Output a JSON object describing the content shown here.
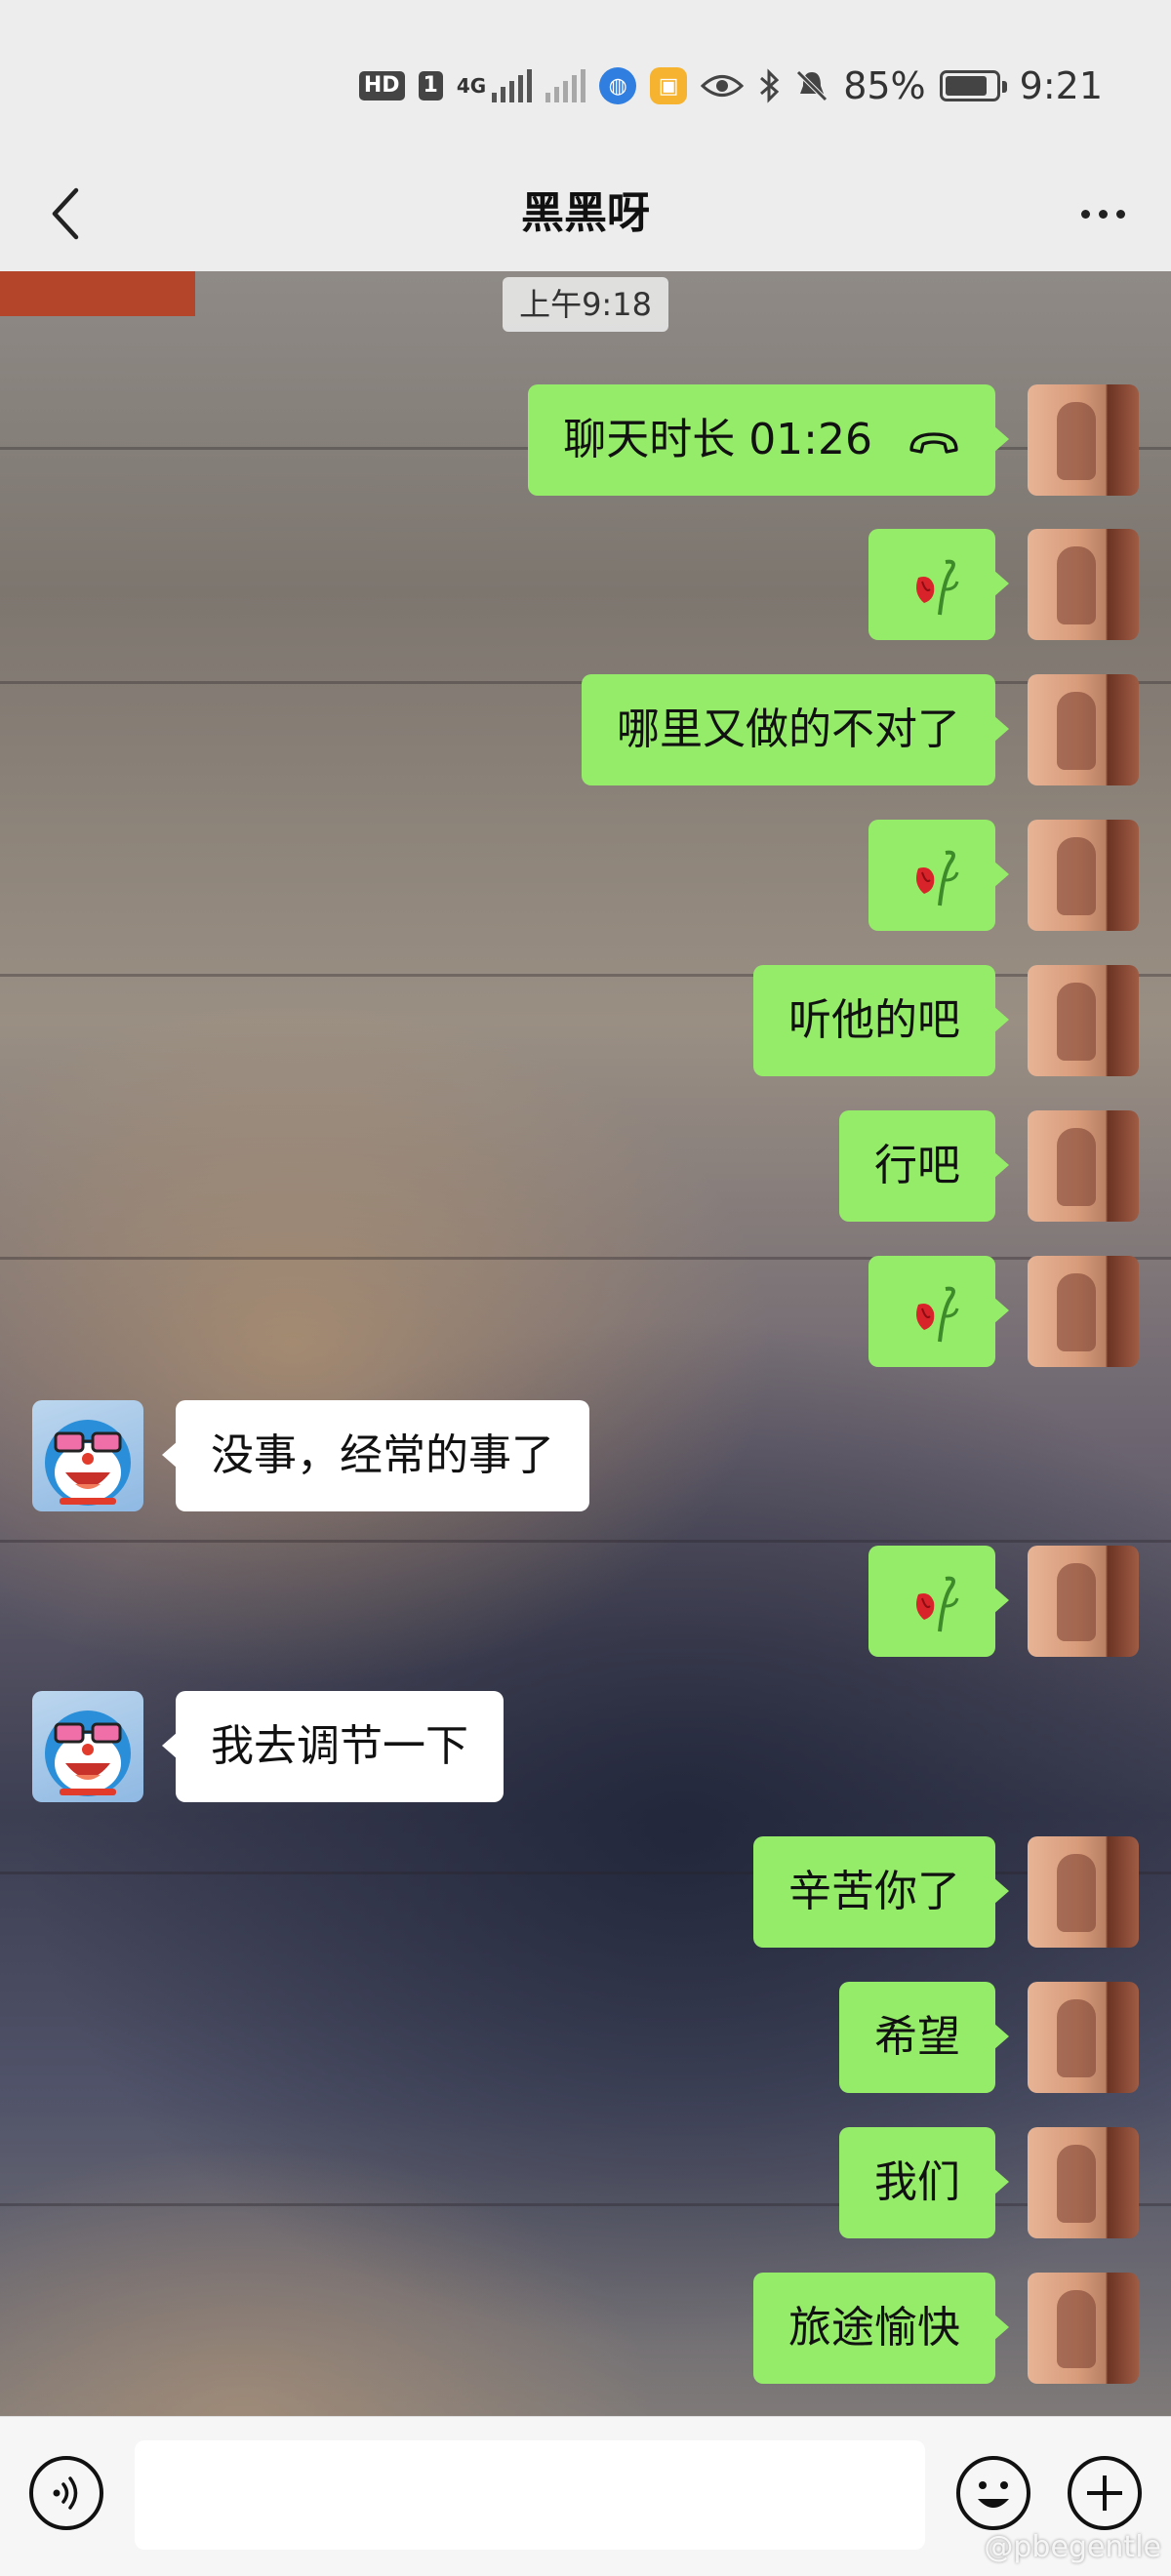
{
  "status_bar": {
    "hd_badge": "HD",
    "sim_badge": "1",
    "network": "4G",
    "battery": "85%",
    "time": "9:21",
    "icons": [
      "hd-icon",
      "signal-icon",
      "no-signal-icon",
      "browser-icon",
      "app-notification-icon",
      "eye-icon",
      "bluetooth-icon",
      "mute-icon",
      "battery-icon"
    ],
    "battery_level": 0.85
  },
  "nav": {
    "title": "黑黑呀",
    "back_icon": "chevron-left-icon",
    "more_icon": "more-dots-icon"
  },
  "chat": {
    "timestamp": "上午9:18",
    "messages": [
      {
        "sender": "me",
        "text": "聊天时长 01:26",
        "type": "call",
        "icon": "phone-hangup-icon"
      },
      {
        "sender": "me",
        "text": "",
        "type": "emoji",
        "icon": "wilted-rose-icon"
      },
      {
        "sender": "me",
        "text": "哪里又做的不对了",
        "type": "text"
      },
      {
        "sender": "me",
        "text": "",
        "type": "emoji",
        "icon": "wilted-rose-icon"
      },
      {
        "sender": "me",
        "text": "听他的吧",
        "type": "text"
      },
      {
        "sender": "me",
        "text": "行吧",
        "type": "text"
      },
      {
        "sender": "me",
        "text": "",
        "type": "emoji",
        "icon": "wilted-rose-icon"
      },
      {
        "sender": "other",
        "text": "没事，经常的事了",
        "type": "text"
      },
      {
        "sender": "me",
        "text": "",
        "type": "emoji",
        "icon": "wilted-rose-icon"
      },
      {
        "sender": "other",
        "text": "我去调节一下",
        "type": "text"
      },
      {
        "sender": "me",
        "text": "辛苦你了",
        "type": "text"
      },
      {
        "sender": "me",
        "text": "希望",
        "type": "text"
      },
      {
        "sender": "me",
        "text": "我们",
        "type": "text"
      },
      {
        "sender": "me",
        "text": "旅途愉快",
        "type": "text"
      }
    ]
  },
  "input_bar": {
    "voice_icon": "voice-icon",
    "text_value": "",
    "emoji_icon": "smiley-icon",
    "plus_icon": "plus-icon",
    "watermark": "@pbegentle"
  },
  "colors": {
    "my_bubble": "#95ec69",
    "other_bubble": "#ffffff",
    "nav_bg": "#ededed"
  }
}
